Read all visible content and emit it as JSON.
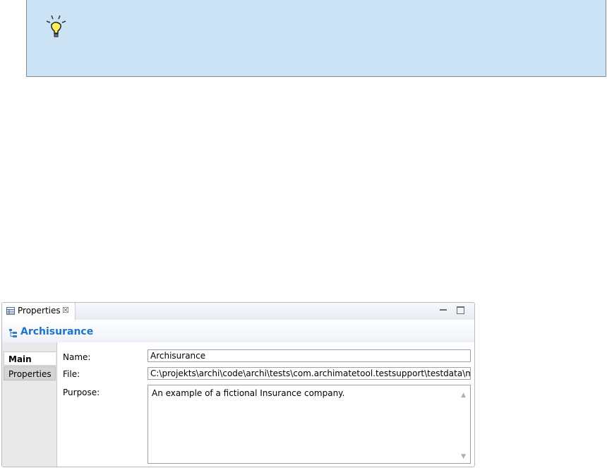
{
  "tip": {
    "icon": "lightbulb-icon"
  },
  "view": {
    "tab_label": "Properties",
    "tab_icon": "properties-table-icon",
    "close_symbol": "☒",
    "title": "Archisurance",
    "title_icon": "model-tree-icon"
  },
  "sidebar": {
    "tabs": [
      {
        "label": "Main",
        "selected": true
      },
      {
        "label": "Properties",
        "selected": false
      }
    ]
  },
  "form": {
    "name_label": "Name:",
    "name_value": "Archisurance",
    "file_label": "File:",
    "file_value": "C:\\projekts\\archi\\code\\archi\\tests\\com.archimatetool.testsupport\\testdata\\models\\A",
    "purpose_label": "Purpose:",
    "purpose_value": "An example of a fictional Insurance company."
  },
  "colors": {
    "tip_bg": "#cce3f6",
    "title_blue": "#1f74c9"
  }
}
